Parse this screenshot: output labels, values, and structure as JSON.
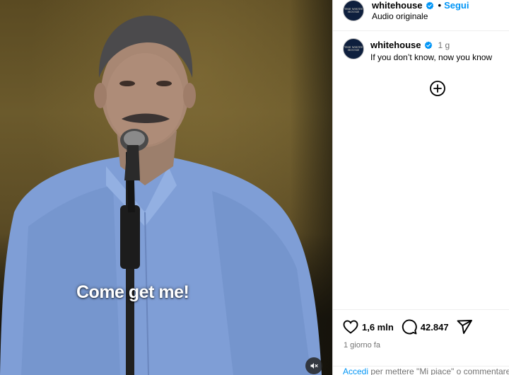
{
  "video": {
    "caption": "Come get me!",
    "mute_icon": "speaker-muted-icon"
  },
  "header": {
    "username": "whitehouse",
    "separator": "•",
    "follow_label": "Segui",
    "audio_label": "Audio originale",
    "avatar_text": "THE WHITE HOUSE"
  },
  "post": {
    "username": "whitehouse",
    "time": "1 g",
    "text": "If you don’t know, now you know"
  },
  "actions": {
    "likes": "1,6 mln",
    "comments": "42.847",
    "date": "1 giorno fa",
    "login_link": "Accedi",
    "login_rest": " per mettere \"Mi piace\" o commentare."
  },
  "colors": {
    "accent": "#0095f6",
    "verified": "#0095f6",
    "muted_text": "#737373"
  }
}
